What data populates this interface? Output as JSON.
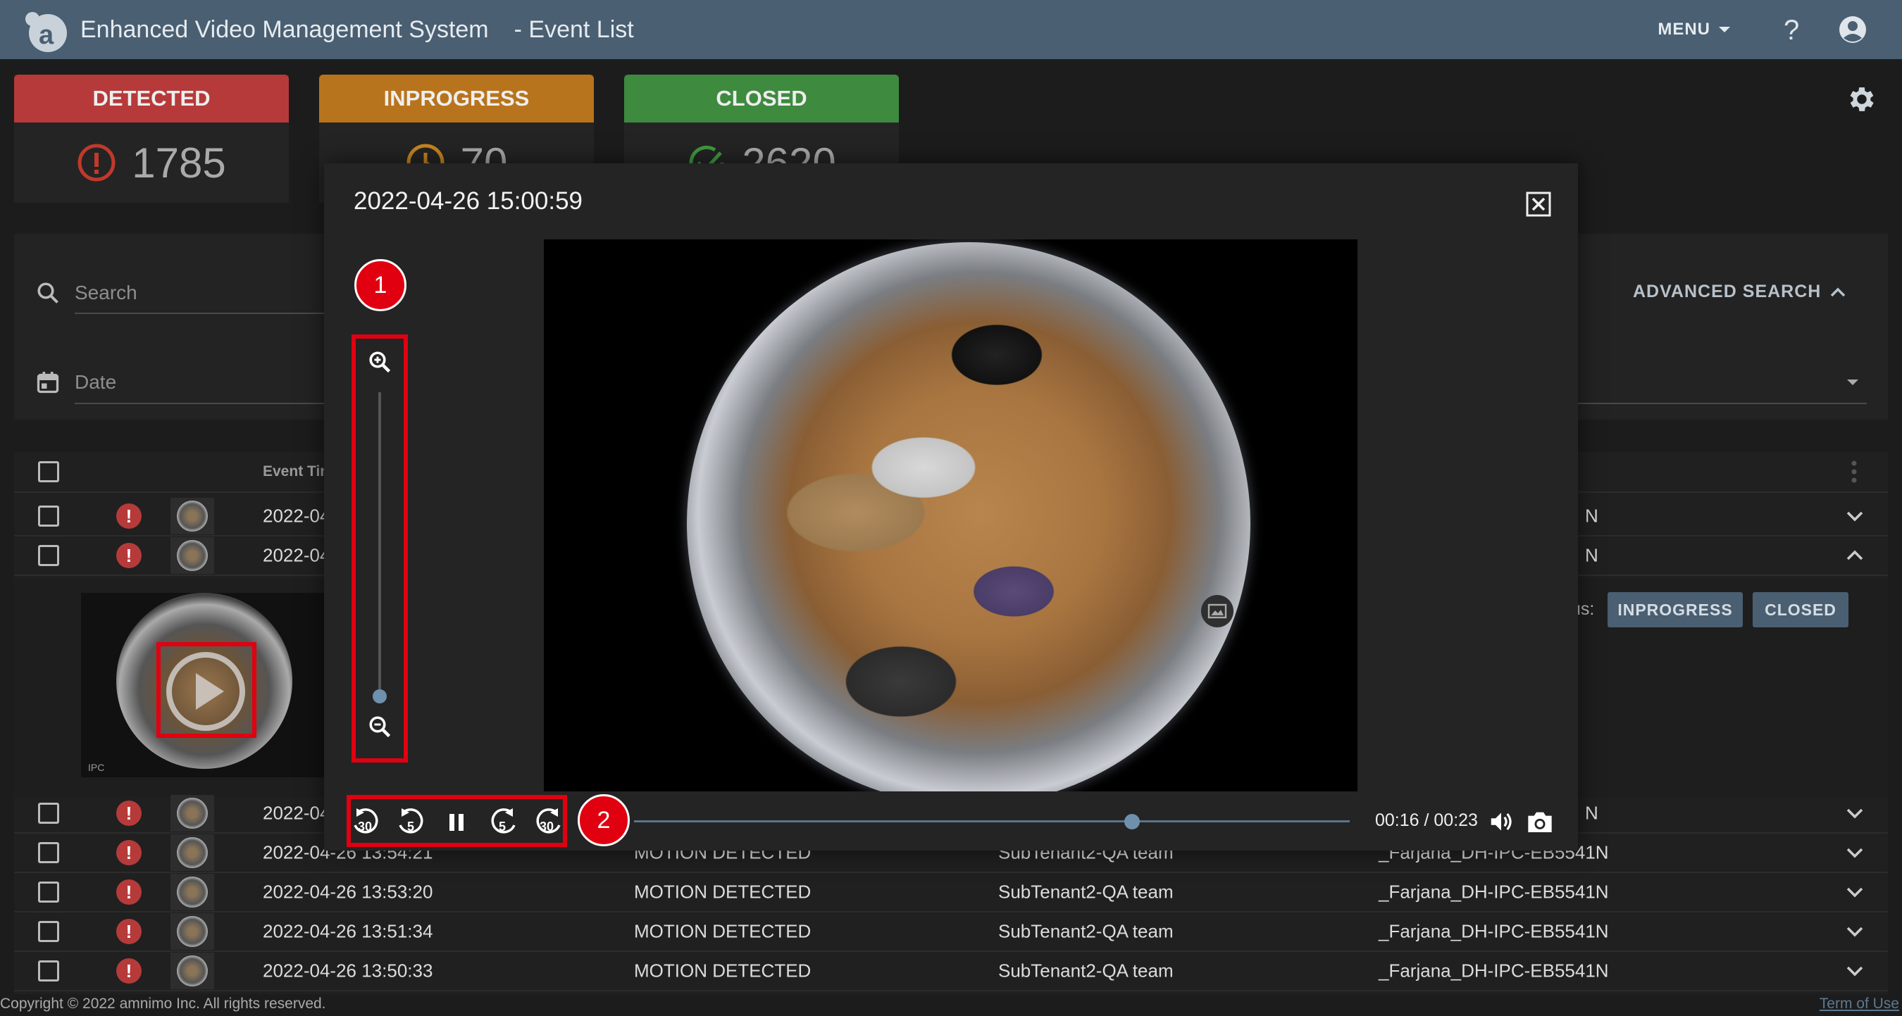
{
  "header": {
    "app_title": "Enhanced Video Management System",
    "page_subtitle": "- Event List",
    "menu_label": "MENU"
  },
  "cards": [
    {
      "label": "DETECTED",
      "count": "1785",
      "color": "#b63a3a"
    },
    {
      "label": "INPROGRESS",
      "count": "70",
      "color": "#b8741c"
    },
    {
      "label": "CLOSED",
      "count": "2620",
      "color": "#3e8a3f"
    }
  ],
  "filters": {
    "search_placeholder": "Search",
    "date_placeholder": "Date",
    "advanced_search_label": "ADVANCED SEARCH"
  },
  "table": {
    "col_event_time": "Event Tin",
    "rows": [
      {
        "time": "2022-04",
        "type": "",
        "tenant": "",
        "camera": "N"
      },
      {
        "time": "2022-04",
        "type": "",
        "tenant": "",
        "camera": "N"
      },
      {
        "time": "2022-04",
        "type": "",
        "tenant": "",
        "camera": "N"
      },
      {
        "time": "2022-04-26 13:54:21",
        "type": "MOTION DETECTED",
        "tenant": "SubTenant2-QA team",
        "camera": "_Farjana_DH-IPC-EB5541N"
      },
      {
        "time": "2022-04-26 13:53:20",
        "type": "MOTION DETECTED",
        "tenant": "SubTenant2-QA team",
        "camera": "_Farjana_DH-IPC-EB5541N"
      },
      {
        "time": "2022-04-26 13:51:34",
        "type": "MOTION DETECTED",
        "tenant": "SubTenant2-QA team",
        "camera": "_Farjana_DH-IPC-EB5541N"
      },
      {
        "time": "2022-04-26 13:50:33",
        "type": "MOTION DETECTED",
        "tenant": "SubTenant2-QA team",
        "camera": "_Farjana_DH-IPC-EB5541N"
      }
    ],
    "expanded": {
      "thumb_label": "IPC",
      "status_label": "us:",
      "btn_inprogress": "INPROGRESS",
      "btn_closed": "CLOSED"
    }
  },
  "modal": {
    "title": "2022-04-26 15:00:59",
    "time_display": "00:16 / 00:23",
    "zoom_level": 0,
    "playback_progress": 0.6957,
    "rewind_30_label": "30",
    "rewind_5_label": "5",
    "forward_5_label": "5",
    "forward_30_label": "30"
  },
  "annotations": {
    "marker_1": "1",
    "marker_2": "2"
  },
  "footer": {
    "copyright": "Copyright © 2022 amnimo Inc. All rights reserved.",
    "terms": "Term of Use"
  }
}
